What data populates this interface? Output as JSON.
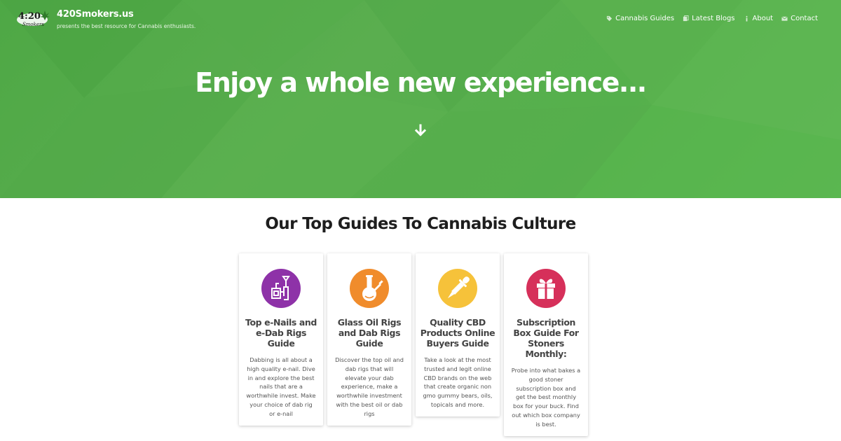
{
  "brand": {
    "logo_alt": "4:20 Smokers",
    "name": "420Smokers.us",
    "tagline": "presents the best resource for Cannabis enthusiasts."
  },
  "nav": {
    "items": [
      {
        "label": "Cannabis Guides",
        "icon": "tag-icon"
      },
      {
        "label": "Latest Blogs",
        "icon": "copy-icon"
      },
      {
        "label": "About",
        "icon": "info-icon"
      },
      {
        "label": "Contact",
        "icon": "envelope-icon"
      }
    ]
  },
  "hero": {
    "title": "Enjoy a whole new experience...",
    "arrow_icon": "arrow-down-icon",
    "color": "#57ae4d"
  },
  "guides": {
    "title": "Our Top Guides To Cannabis Culture",
    "cards": [
      {
        "icon": "enail-icon",
        "color": "#8e32a8",
        "title": "Top e-Nails and e-Dab Rigs Guide",
        "description": "Dabbing is all about a high quality e-nail. Dive in and explore the best nails that are a worthwhile invest. Make your choice of dab rig or e-nail"
      },
      {
        "icon": "bong-icon",
        "color": "#f08c2c",
        "title": "Glass Oil Rigs and Dab Rigs Guide",
        "description": "Discover the top oil and dab rigs that will elevate your dab experience, make a worthwhile investment with the best oil or dab rigs"
      },
      {
        "icon": "dropper-icon",
        "color": "#f6c23a",
        "title": "Quality CBD Products Online Buyers Guide",
        "description": "Take a look at the most trusted and legit online CBD brands on the web that create organic non gmo gummy bears, oils, topicals and more."
      },
      {
        "icon": "gift-icon",
        "color": "#d6305a",
        "title": "Subscription Box Guide For Stoners Monthly:",
        "description": "Probe into what bakes a good stoner subscription box and get the best monthly box for your buck. Find out which box company is best."
      }
    ]
  }
}
